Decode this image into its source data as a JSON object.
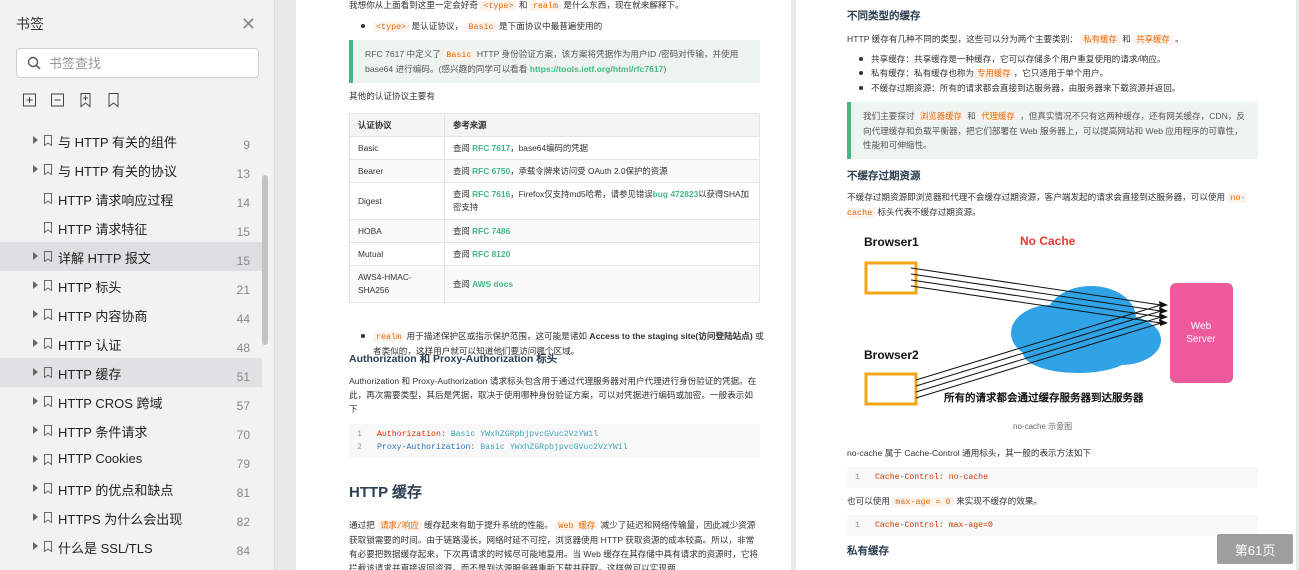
{
  "sidebar": {
    "title": "书签",
    "search_placeholder": "书签查找",
    "items": [
      {
        "label": "与 HTTP 有关的组件",
        "page": "9",
        "expandable": true
      },
      {
        "label": "与 HTTP 有关的协议",
        "page": "13",
        "expandable": true
      },
      {
        "label": "HTTP 请求响应过程",
        "page": "14",
        "expandable": false
      },
      {
        "label": "HTTP 请求特征",
        "page": "15",
        "expandable": false
      },
      {
        "label": "详解 HTTP 报文",
        "page": "15",
        "expandable": true
      },
      {
        "label": "HTTP 标头",
        "page": "21",
        "expandable": true
      },
      {
        "label": "HTTP 内容协商",
        "page": "44",
        "expandable": true
      },
      {
        "label": "HTTP 认证",
        "page": "48",
        "expandable": true
      },
      {
        "label": "HTTP 缓存",
        "page": "51",
        "expandable": true
      },
      {
        "label": "HTTP CROS 跨域",
        "page": "57",
        "expandable": true
      },
      {
        "label": "HTTP 条件请求",
        "page": "70",
        "expandable": true
      },
      {
        "label": "HTTP Cookies",
        "page": "79",
        "expandable": true
      },
      {
        "label": "HTTP 的优点和缺点",
        "page": "81",
        "expandable": true
      },
      {
        "label": "HTTPS 为什么会出现",
        "page": "82",
        "expandable": true
      },
      {
        "label": "什么是 SSL/TLS",
        "page": "84",
        "expandable": true
      }
    ]
  },
  "left_page": {
    "intro_a": "我想你从上面看到这里一定会好奇",
    "intro_code1": "<type>",
    "intro_and": "和",
    "intro_code2": "realm",
    "intro_b": "是什么东西，现在就来解释下。",
    "bullet1_code": "<type>",
    "bullet1_a": "是认证协议，",
    "bullet1_code2": "Basic",
    "bullet1_b": "是下面协议中最普遍使用的",
    "tip_a": "RFC 7617 中定义了",
    "tip_code": "Basic",
    "tip_b": "HTTP 身份验证方案，该方案将凭据作为用户ID /密码对传输，并使用 base64 进行编码。(感兴趣的同学可以看看",
    "tip_link": "https://tools.ietf.org/html/rfc7617",
    "tip_c": ")",
    "other_protocols": "其他的认证协议主要有",
    "table_headers": [
      "认证协议",
      "参考来源"
    ],
    "table_rows": [
      {
        "proto": "Basic",
        "pre": "查阅",
        "link": "RFC 7617",
        "post": "，base64编码的凭据"
      },
      {
        "proto": "Bearer",
        "pre": "查阅",
        "link": "RFC 6750",
        "post": "，承载令牌来访问受 OAuth 2.0保护的资源"
      },
      {
        "proto": "Digest",
        "pre": "查阅",
        "link": "RFC 7616",
        "post": "，Firefox仅支持md5哈希，请参见错误",
        "link2": "bug 472823",
        "post2": "以获得SHA加密支持"
      },
      {
        "proto": "HOBA",
        "pre": "查阅",
        "link": "RFC 7486",
        "post": ""
      },
      {
        "proto": "Mutual",
        "pre": "查阅",
        "link": "RFC 8120",
        "post": ""
      },
      {
        "proto": "AWS4-HMAC-SHA256",
        "pre": "查阅",
        "link": "AWS docs",
        "post": ""
      }
    ],
    "realm_code": "realm",
    "realm_a": "用于描述保护区或指示保护范围，这可能是诸如",
    "realm_bold": "Access to the staging site(访问登陆站点)",
    "realm_b": "或者类似的，这样用户就可以知道他们要访问哪个区域。",
    "h3_auth": "Authorization 和 Proxy-Authorization 标头",
    "auth_para": "Authorization 和 Proxy-Authorization 请求标头包含用于通过代理服务器对用户代理进行身份验证的凭据。在此，再次需要类型，其后是凭据，取决于使用哪种身份验证方案，可以对凭据进行编码或加密。一般表示如下",
    "code_lines": [
      {
        "n": "1",
        "key": "Authorization:",
        "type": "Basic",
        "val": "YWxhZGRpbjpvcGVuc2VzYW1l"
      },
      {
        "n": "2",
        "key": "Proxy-Authorization:",
        "type": "Basic",
        "val": "YWxhZGRpbjpvcGVuc2VzYW1l"
      }
    ],
    "h2_cache": "HTTP 缓存",
    "cache_a": "通过把",
    "cache_code1": "请求/响应",
    "cache_b": "缓存起来有助于提升系统的性能。",
    "cache_code2": "Web 缓存",
    "cache_c": "减少了延迟和网络传输量，因此减少资源获取锁需要的时间。由于链路漫长，网络时延不可控，浏览器使用 HTTP 获取资源的成本较高。所以，非常有必要把数据缓存起来，下次再请求的时候尽可能地复用。当 Web 缓存在其存储中具有请求的资源时，它将拦截该请求并直接返回资源，而不是到达源服务器重新下载并获取。这样做可以实现两"
  },
  "right_page": {
    "h3_types": "不同类型的缓存",
    "types_a": "HTTP 缓存有几种不同的类型，这些可以分为两个主要类别：",
    "types_code1": "私有缓存",
    "types_and": "和",
    "types_code2": "共享缓存",
    "types_end": "。",
    "bullets": [
      {
        "a": "共享缓存：共享缓存是一种缓存，它可以存储多个用户重复使用的请求/响应。",
        "code": "",
        "b": ""
      },
      {
        "a": "私有缓存：私有缓存也称为",
        "code": "专用缓存",
        "b": "，它只适用于单个用户。"
      },
      {
        "a": "不缓存过期资源：所有的请求都会直接到达服务器，由服务器来下载资源并返回。",
        "code": "",
        "b": ""
      }
    ],
    "tip_a": "我们主要探讨",
    "tip_code1": "浏览器缓存",
    "tip_and": "和",
    "tip_code2": "代理缓存",
    "tip_b": "，但真实情况不只有这两种缓存，还有网关缓存，CDN，反向代理缓存和负载平衡器，把它们部署在 Web 服务器上，可以提高网站和 Web 应用程序的可靠性，性能和可伸缩性。",
    "h3_nocache": "不缓存过期资源",
    "nocache_a": "不缓存过期资源即浏览器和代理不会缓存过期资源，客户端发起的请求会直接到达服务器，可以使用",
    "nocache_code": "no-cache",
    "nocache_b": "标头代表不缓存过期资源。",
    "diagram": {
      "browser1": "Browser1",
      "browser2": "Browser2",
      "no_cache": "No Cache",
      "server_line1": "Web",
      "server_line2": "Server",
      "caption_bold": "所有的请求都会通过缓存服务器到达服务器",
      "caption": "no-cache 示意图"
    },
    "nocache_desc": "no-cache 属于 Cache-Control 通用标头，其一般的表示方法如下",
    "code1": {
      "n": "1",
      "text": "Cache-Control: no-cache"
    },
    "maxage_a": "也可以使用",
    "maxage_code": "max-age = 0",
    "maxage_b": "来实现不缓存的效果。",
    "code2": {
      "n": "1",
      "text": "Cache-Control: max-age=0"
    },
    "h3_private": "私有缓存"
  },
  "page_indicator": "第61页",
  "colors": {
    "accent_green": "#42b983",
    "code_orange": "#e96900",
    "server_pink": "#ee5a9b",
    "cloud_blue": "#2fa3e6",
    "no_cache_red": "#e53935"
  }
}
